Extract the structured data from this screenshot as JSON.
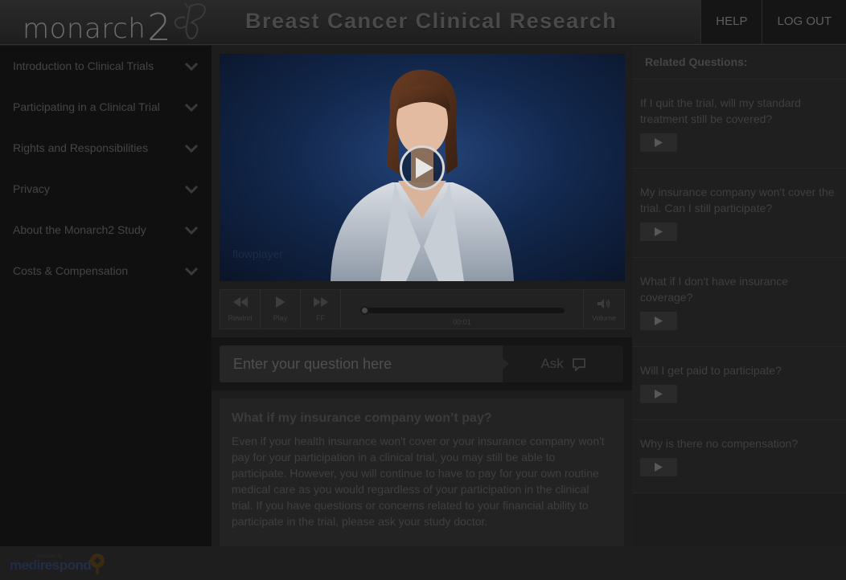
{
  "header": {
    "logo_text": "monarch",
    "logo_number": "2",
    "title": "Breast Cancer Clinical Research",
    "help_label": "HELP",
    "logout_label": "LOG OUT"
  },
  "sidebar": {
    "items": [
      {
        "label": "Introduction to Clinical Trials"
      },
      {
        "label": "Participating in a Clinical Trial"
      },
      {
        "label": "Rights and Responsibilities"
      },
      {
        "label": "Privacy"
      },
      {
        "label": "About the Monarch2 Study"
      },
      {
        "label": "Costs & Compensation"
      }
    ]
  },
  "video": {
    "watermark": "flowplayer",
    "controls": {
      "rewind_label": "Rewind",
      "play_label": "Play",
      "ff_label": "FF",
      "time": "00:01",
      "volume_label": "Volume"
    }
  },
  "ask": {
    "placeholder": "Enter your question here",
    "button_label": "Ask"
  },
  "answer": {
    "title": "What if my insurance company won’t pay?",
    "body": "Even if your health insurance won't cover or your insurance company won't pay for your participation in a clinical trial, you may still be able to participate. However, you will continue to have to pay for your own routine medical care as you would regardless of your participation in the clinical trial. If you have questions or concerns related to your financial ability to participate in the trial, please ask your study doctor."
  },
  "related": {
    "heading": "Related Questions:",
    "items": [
      {
        "question": "If I quit the trial, will my standard treatment still be covered?"
      },
      {
        "question": "My insurance company won't cover the trial. Can I still participate?"
      },
      {
        "question": "What if I don't have insurance coverage?"
      },
      {
        "question": "Will I get paid to participate?"
      },
      {
        "question": "Why is there no compensation?"
      }
    ]
  },
  "footer": {
    "powered_by": "Powered by",
    "brand_part1": "medi",
    "brand_part2": "respond"
  },
  "colors": {
    "background": "#1b1b1b",
    "sidebar": "#101010",
    "video_bg": "#13294f",
    "text_dim": "#454545"
  }
}
